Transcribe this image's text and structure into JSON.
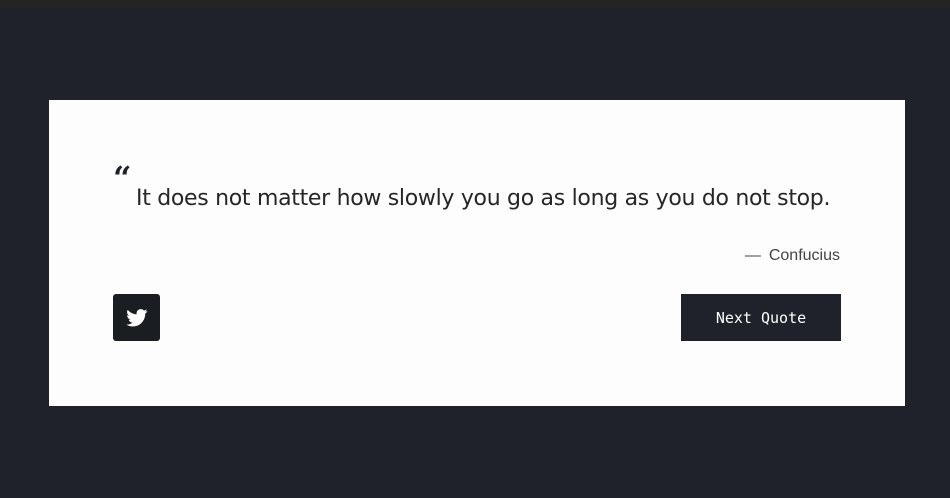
{
  "quote": {
    "open_mark": "“",
    "text": "It does not matter how slowly you go as long as you do not stop.",
    "author_dash": "—",
    "author": "Confucius"
  },
  "actions": {
    "tweet_icon": "twitter-icon",
    "next_label": "Next Quote"
  },
  "colors": {
    "background": "#1f222a",
    "card": "#fdfdfe",
    "button": "#1f222a",
    "button_text": "#ffffff"
  }
}
